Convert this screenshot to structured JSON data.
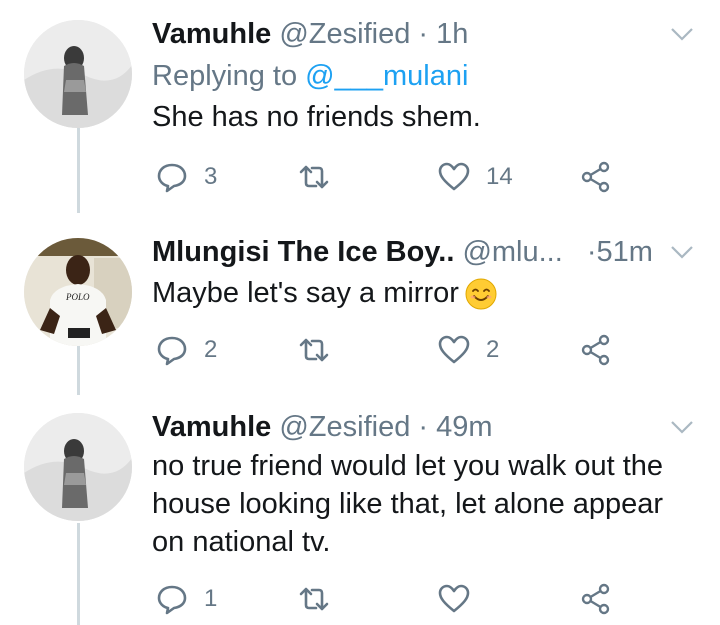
{
  "tweets": [
    {
      "name": "Vamuhle",
      "handle": "@Zesified",
      "dot": "·",
      "time": "1h",
      "replying_prefix": "Replying to",
      "replying_mention": "@___mulani",
      "text": "She has no friends shem.",
      "reply_count": "3",
      "retweet_count": "",
      "like_count": "14"
    },
    {
      "name": "Mlungisi The Ice Boy..",
      "handle": "@mlu...",
      "dot": "·",
      "time": "51m",
      "text": "Maybe let's say a mirror",
      "reply_count": "2",
      "retweet_count": "",
      "like_count": "2",
      "avatar_shirt_text": "POLO"
    },
    {
      "name": "Vamuhle",
      "handle": "@Zesified",
      "dot": "·",
      "time": "49m",
      "text_lines": [
        "no true friend would let you walk out the",
        "house looking like that, let alone appear",
        "on national tv."
      ],
      "reply_count": "1",
      "retweet_count": "",
      "like_count": ""
    }
  ],
  "icons": {
    "reply": "reply-icon",
    "retweet": "retweet-icon",
    "like": "heart-icon",
    "share": "share-icon",
    "menu": "chevron-down-icon",
    "emoji": "smiling-face-emoji"
  },
  "colors": {
    "text": "#14171a",
    "secondary": "#657786",
    "link": "#1da1f2",
    "line": "#cfd9de",
    "emoji": "#ffcc33"
  }
}
